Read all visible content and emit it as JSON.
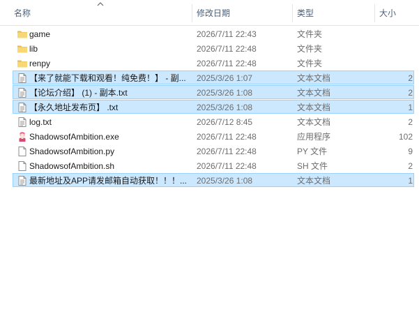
{
  "columns": {
    "name": "名称",
    "modified": "修改日期",
    "type": "类型",
    "size": "大小"
  },
  "files": [
    {
      "name": "game",
      "modified": "2026/7/11 22:43",
      "type": "文件夹",
      "size": "",
      "icon": "folder-icon",
      "selected": false
    },
    {
      "name": "lib",
      "modified": "2026/7/11 22:48",
      "type": "文件夹",
      "size": "",
      "icon": "folder-icon",
      "selected": false
    },
    {
      "name": "renpy",
      "modified": "2026/7/11 22:48",
      "type": "文件夹",
      "size": "",
      "icon": "folder-icon",
      "selected": false
    },
    {
      "name": "【来了就能下载和观看！纯免费！】 - 副...",
      "modified": "2025/3/26 1:07",
      "type": "文本文档",
      "size": "2",
      "icon": "text-file-icon",
      "selected": true
    },
    {
      "name": "【论坛介绍】 (1) - 副本.txt",
      "modified": "2025/3/26 1:08",
      "type": "文本文档",
      "size": "2",
      "icon": "text-file-icon",
      "selected": true
    },
    {
      "name": "【永久地址发布页】 .txt",
      "modified": "2025/3/26 1:08",
      "type": "文本文档",
      "size": "1",
      "icon": "text-file-icon",
      "selected": true
    },
    {
      "name": "log.txt",
      "modified": "2026/7/12 8:45",
      "type": "文本文档",
      "size": "2",
      "icon": "text-file-icon",
      "selected": false
    },
    {
      "name": "ShadowsofAmbition.exe",
      "modified": "2026/7/11 22:48",
      "type": "应用程序",
      "size": "102",
      "icon": "application-icon",
      "selected": false
    },
    {
      "name": "ShadowsofAmbition.py",
      "modified": "2026/7/11 22:48",
      "type": "PY 文件",
      "size": "9",
      "icon": "generic-file-icon",
      "selected": false
    },
    {
      "name": "ShadowsofAmbition.sh",
      "modified": "2026/7/11 22:48",
      "type": "SH 文件",
      "size": "2",
      "icon": "generic-file-icon",
      "selected": false
    },
    {
      "name": "最新地址及APP请发邮箱自动获取！！！...",
      "modified": "2025/3/26 1:08",
      "type": "文本文档",
      "size": "1",
      "icon": "text-file-icon",
      "selected": true
    }
  ],
  "colors": {
    "selection_fill": "#cce8ff",
    "selection_border": "#99d1ff",
    "folder": "#f8d775",
    "header_text": "#4c607a"
  }
}
